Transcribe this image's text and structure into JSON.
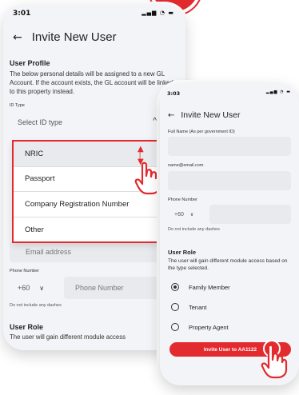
{
  "phone1": {
    "status_time": "3:01",
    "status_icons": "signal wifi battery",
    "title": "Invite New User",
    "profile_title": "User Profile",
    "profile_desc": "The below personal details will be assigned to a new GL Account. If the account exists, the GL account will be linked to this property instead.",
    "id_type_label": "ID Type",
    "id_type_placeholder": "Select ID type",
    "dropdown_options": [
      "NRIC",
      "Passport",
      "Company Registration Number",
      "Other"
    ],
    "email_placeholder": "Email address",
    "phone_label": "Phone Number",
    "country_code": "+60",
    "phone_placeholder": "Phone Number",
    "phone_hint": "Do not include any dashes",
    "role_title": "User Role",
    "role_desc": "The user will gain different module access"
  },
  "phone2": {
    "status_time": "3:03",
    "title": "Invite New User",
    "fullname_label": "Full Name (As per government ID)",
    "email_label": "name@email.com",
    "phone_label": "Phone Number",
    "country_code": "+60",
    "phone_hint": "Do not include any dashes",
    "role_title": "User Role",
    "role_desc": "The user will gain different module access based on the type selected.",
    "roles": [
      {
        "label": "Family Member",
        "checked": true
      },
      {
        "label": "Tenant",
        "checked": false
      },
      {
        "label": "Property Agent",
        "checked": false
      }
    ],
    "invite_button": "Invite User to AA1122"
  },
  "colors": {
    "accent": "#e32b2f",
    "field": "#e9eaee",
    "background": "#f3f4f7"
  }
}
